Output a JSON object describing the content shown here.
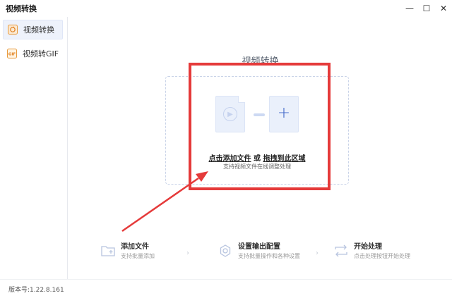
{
  "window": {
    "title": "视频转换",
    "controls": {
      "minimize": "—",
      "maximize": "☐",
      "close": "✕"
    }
  },
  "sidebar": {
    "items": [
      {
        "label": "视频转换",
        "icon": "video-convert-icon",
        "active": true
      },
      {
        "label": "视频转GIF",
        "icon": "gif-icon",
        "active": false
      }
    ]
  },
  "main": {
    "title": "视频转换",
    "dropzone": {
      "action_click": "点击添加文件",
      "action_or": "或",
      "action_drag": "拖拽到此区域",
      "subtitle": "支持视频文件在线调整处理"
    }
  },
  "steps": [
    {
      "title": "添加文件",
      "desc": "支持批量添加",
      "icon": "add-folder-icon"
    },
    {
      "title": "设置输出配置",
      "desc": "支持批量操作和各种设置",
      "icon": "settings-gear-icon"
    },
    {
      "title": "开始处理",
      "desc": "点击处理按钮开始处理",
      "icon": "swap-arrows-icon"
    }
  ],
  "footer": {
    "version": "版本号:1.22.8.161"
  },
  "colors": {
    "accent": "#3e66c8",
    "highlight_red": "#e53a3a",
    "sidebar_active_bg": "#eef2fb"
  }
}
